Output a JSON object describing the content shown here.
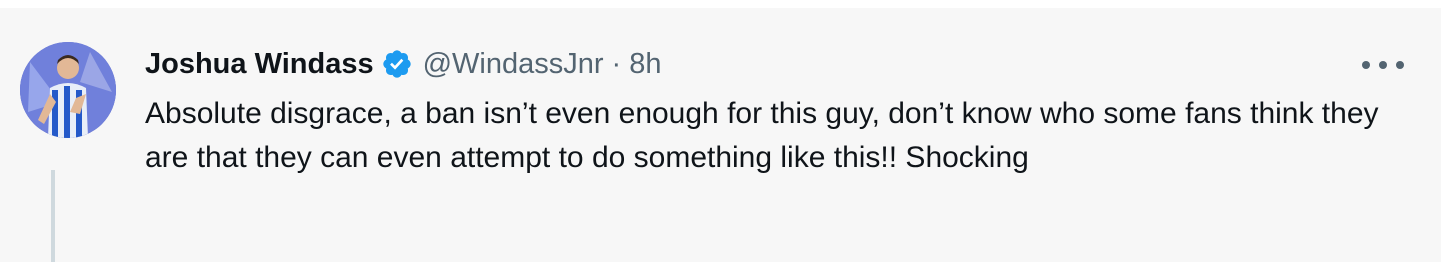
{
  "tweet": {
    "display_name": "Joshua Windass",
    "handle": "@WindassJnr",
    "separator": "·",
    "time": "8h",
    "text": "Absolute disgrace, a ban isn’t even enough for this guy, don’t know who some fans think they are that they can even attempt to do something like this!! Shocking",
    "verified": true,
    "more_icon": "more-horizontal-icon",
    "verified_icon": "verified-badge-icon"
  },
  "colors": {
    "background": "#f7f7f7",
    "verified_blue": "#1d9bf0",
    "secondary_text": "#536471",
    "primary_text": "#0f1419",
    "thread_line": "#cfd9de"
  }
}
